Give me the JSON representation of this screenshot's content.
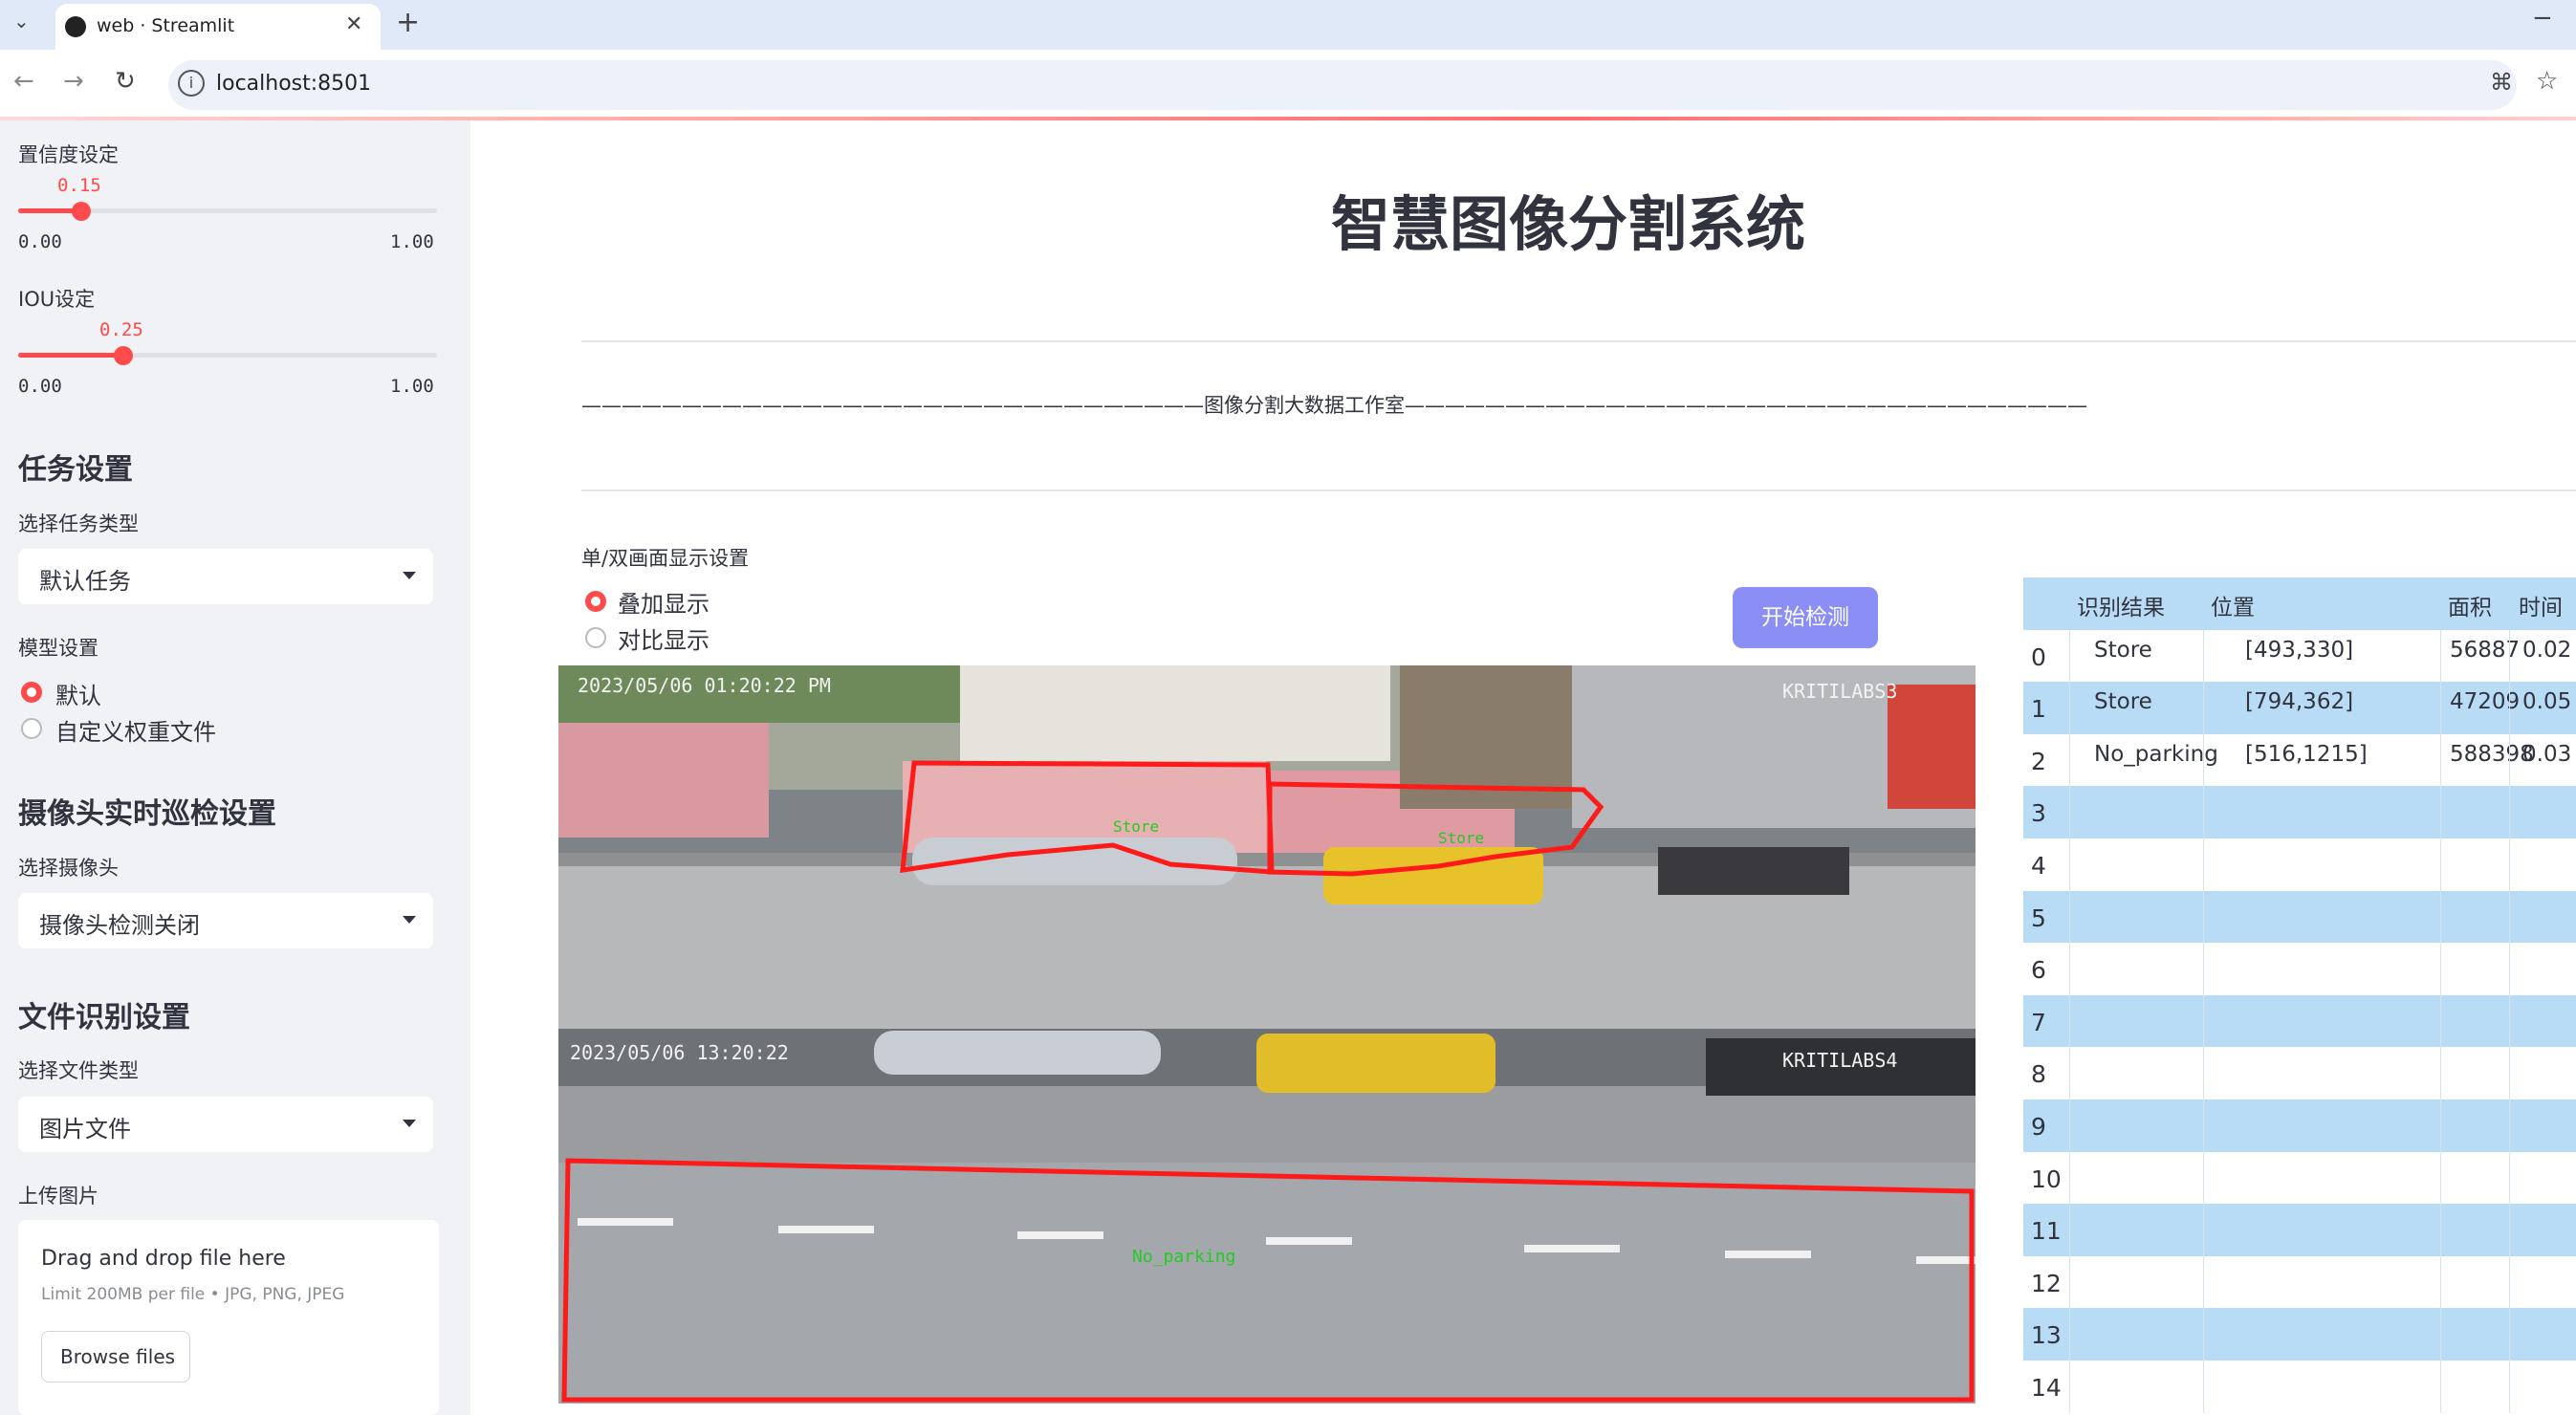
{
  "browser": {
    "tab_title": "web · Streamlit",
    "url": "localhost:8501"
  },
  "sidebar": {
    "confidence": {
      "label": "置信度设定",
      "value": "0.15",
      "min": "0.00",
      "max": "1.00",
      "fraction": 0.15
    },
    "iou": {
      "label": "IOU设定",
      "value": "0.25",
      "min": "0.00",
      "max": "1.00",
      "fraction": 0.25
    },
    "task_section": "任务设置",
    "task_type_label": "选择任务类型",
    "task_type_value": "默认任务",
    "model_label": "模型设置",
    "model_options": [
      "默认",
      "自定义权重文件"
    ],
    "model_selected": 0,
    "camera_section": "摄像头实时巡检设置",
    "camera_label": "选择摄像头",
    "camera_value": "摄像头检测关闭",
    "file_section": "文件识别设置",
    "file_type_label": "选择文件类型",
    "file_type_value": "图片文件",
    "upload_label": "上传图片",
    "upload_title": "Drag and drop file here",
    "upload_hint": "Limit 200MB per file • JPG, PNG, JPEG",
    "browse_label": "Browse files"
  },
  "main": {
    "title": "智慧图像分割系统",
    "subtitle": "———————————————————————————————图像分割大数据工作室——————————————————————————————————",
    "display_label": "单/双画面显示设置",
    "display_options": [
      "叠加显示",
      "对比显示"
    ],
    "display_selected": 0,
    "detect_button": "开始检测"
  },
  "image": {
    "timestamp_top": "2023/05/06 01:20:22 PM",
    "cam_top": "KRITILABS3",
    "timestamp_bottom": "2023/05/06 13:20:22",
    "cam_bottom": "KRITILABS4",
    "label_no_parking": "No_parking",
    "label_store": "Store",
    "outline_color": "#ff1a1a",
    "label_color": "#22cc22"
  },
  "table": {
    "columns": [
      "",
      "识别结果",
      "位置",
      "面积",
      "时间"
    ],
    "rows": [
      {
        "idx": "0",
        "result": "Store",
        "pos": "[493,330]",
        "area": "56887",
        "time": "0.02"
      },
      {
        "idx": "1",
        "result": "Store",
        "pos": "[794,362]",
        "area": "47209",
        "time": "0.05"
      },
      {
        "idx": "2",
        "result": "No_parking",
        "pos": "[516,1215]",
        "area": "588398",
        "time": "0.03"
      },
      {
        "idx": "3",
        "result": "",
        "pos": "",
        "area": "",
        "time": ""
      },
      {
        "idx": "4",
        "result": "",
        "pos": "",
        "area": "",
        "time": ""
      },
      {
        "idx": "5",
        "result": "",
        "pos": "",
        "area": "",
        "time": ""
      },
      {
        "idx": "6",
        "result": "",
        "pos": "",
        "area": "",
        "time": ""
      },
      {
        "idx": "7",
        "result": "",
        "pos": "",
        "area": "",
        "time": ""
      },
      {
        "idx": "8",
        "result": "",
        "pos": "",
        "area": "",
        "time": ""
      },
      {
        "idx": "9",
        "result": "",
        "pos": "",
        "area": "",
        "time": ""
      },
      {
        "idx": "10",
        "result": "",
        "pos": "",
        "area": "",
        "time": ""
      },
      {
        "idx": "11",
        "result": "",
        "pos": "",
        "area": "",
        "time": ""
      },
      {
        "idx": "12",
        "result": "",
        "pos": "",
        "area": "",
        "time": ""
      },
      {
        "idx": "13",
        "result": "",
        "pos": "",
        "area": "",
        "time": ""
      },
      {
        "idx": "14",
        "result": "",
        "pos": "",
        "area": "",
        "time": ""
      }
    ]
  }
}
